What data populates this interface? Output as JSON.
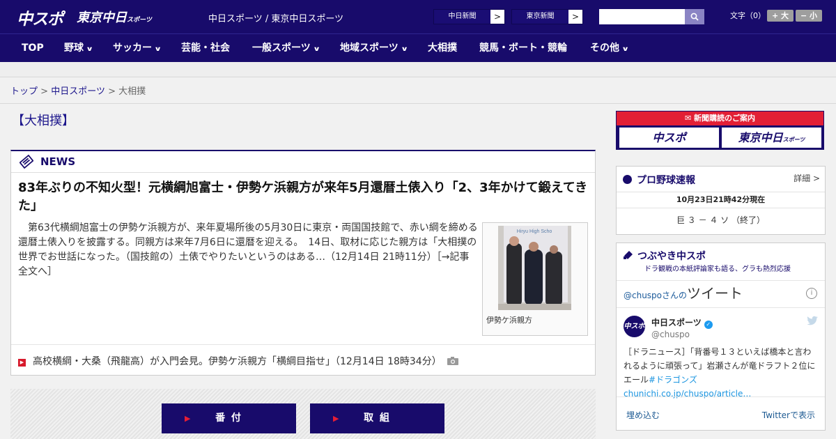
{
  "header": {
    "logo_chuspo": "中スポ",
    "logo_tokyo": "東京中日",
    "logo_tokyo_small": "スポーツ",
    "site_names": "中日スポーツ / 東京中日スポーツ",
    "paper1": "中日新聞",
    "paper2": "東京新聞",
    "arrow": ">",
    "search_placeholder": "",
    "fontsize_label": "文字（0）",
    "font_bigger": "+ 大",
    "font_smaller": "− 小"
  },
  "nav": [
    {
      "label": "TOP",
      "chevron": false
    },
    {
      "label": "野球",
      "chevron": true
    },
    {
      "label": "サッカー",
      "chevron": true
    },
    {
      "label": "芸能・社会",
      "chevron": false
    },
    {
      "label": "一般スポーツ",
      "chevron": true
    },
    {
      "label": "地域スポーツ",
      "chevron": true
    },
    {
      "label": "大相撲",
      "chevron": false
    },
    {
      "label": "競馬・ボート・競輪",
      "chevron": false
    },
    {
      "label": "その他",
      "chevron": true
    }
  ],
  "breadcrumb": {
    "home": "トップ",
    "sep": ">",
    "section": "中日スポーツ",
    "current": "大相撲"
  },
  "section_title": "【大相撲】",
  "news": {
    "label": "NEWS",
    "headline": "83年ぶりの不知火型！元横綱旭富士・伊勢ケ浜親方が来年5月還暦土俵入り「2、3年かけて鍛えてきた」",
    "body": "　第63代横綱旭富士の伊勢ケ浜親方が、来年夏場所後の5月30日に東京・両国国技館で、赤い綱を締める還暦土俵入りを披露する。同親方は来年7月6日に還暦を迎える。　14日、取材に応じた親方は「大相撲の世界でお世話になった。（国技館の）土俵でやりたいというのはある…（12月14日 21時11分）［→記事全文へ］",
    "photo_caption": "伊勢ケ浜親方",
    "photo_sign": "Hiryu High Scho",
    "sub_headline": "高校横綱・大桑（飛龍高）が入門会見。伊勢ケ浜親方「横綱目指せ」（12月14日 18時34分）"
  },
  "buttons": {
    "banzuke": "番 付",
    "torikumi": "取 組"
  },
  "banner": {
    "title": "新聞購読のご案内",
    "left": "中スポ",
    "right": "東京中日",
    "right_small": "スポーツ"
  },
  "baseball": {
    "title": "プロ野球速報",
    "detail": "詳細 >",
    "time": "10月23日21時42分現在",
    "score": "巨 ３ － ４ ソ （終了）"
  },
  "tweets": {
    "title": "つぶやき中スポ",
    "subtitle": "ドラ観戦の本紙評論家も語る、グラも熱烈応援",
    "handle_prefix": "@chuspoさんの",
    "word": "ツイート",
    "info": "i",
    "account_name": "中日スポーツ",
    "account_handle": "@chuspo",
    "tweet_text": "［ドラニュース］「背番号１３といえば橋本と言われるように頑張って」岩瀬さんが竜ドラフト２位にエール",
    "tweet_tail": "#ドラゴンズchunichi.co.jp/chuspo/article…",
    "embed": "埋め込む",
    "view": "Twitterで表示",
    "avatar": "中スポ",
    "verified": "✓"
  },
  "colors": {
    "navy": "#180b6b",
    "red": "#e21f35"
  }
}
